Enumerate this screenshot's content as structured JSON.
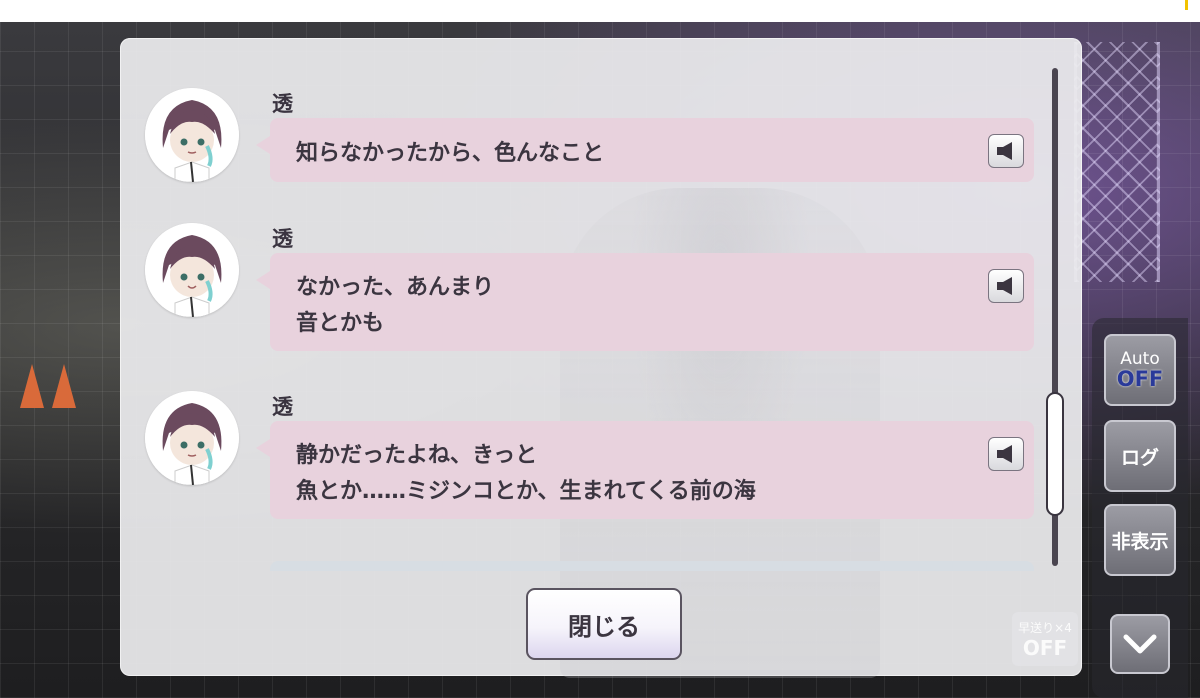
{
  "log": {
    "entries": [
      {
        "speaker": "透",
        "lines": [
          "知らなかったから、色んなこと"
        ]
      },
      {
        "speaker": "透",
        "lines": [
          "なかった、あんまり",
          "音とかも"
        ]
      },
      {
        "speaker": "透",
        "lines": [
          "静かだったよね、きっと",
          "魚とか……ミジンコとか、生まれてくる前の海"
        ]
      }
    ],
    "close_label": "閉じる",
    "voice_icon": "speaker-icon"
  },
  "controls": {
    "auto_label": "Auto",
    "auto_state": "OFF",
    "log_label": "ログ",
    "hide_label": "非表示",
    "fast_forward_label": "早送り×4",
    "fast_forward_state": "OFF",
    "menu_icon": "chevron-down-icon"
  },
  "colors": {
    "bubble": "#e8d2dd",
    "panel": "#ececee",
    "auto_off": "#2a3a9a"
  }
}
